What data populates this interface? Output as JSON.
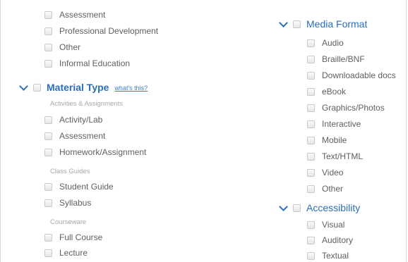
{
  "top_list": [
    "Assessment",
    "Professional Development",
    "Other",
    "Informal Education"
  ],
  "material_type": {
    "title": "Material Type",
    "link": "what's this?",
    "groups": [
      {
        "label": "Activities & Assignments",
        "items": [
          "Activity/Lab",
          "Assessment",
          "Homework/Assignment"
        ]
      },
      {
        "label": "Class Guides",
        "items": [
          "Student Guide",
          "Syllabus"
        ]
      },
      {
        "label": "Courseware",
        "items": [
          "Full Course",
          "Lecture"
        ]
      }
    ]
  },
  "media_format": {
    "title": "Media Format",
    "items": [
      "Audio",
      "Braille/BNF",
      "Downloadable docs",
      "eBook",
      "Graphics/Photos",
      "Interactive",
      "Mobile",
      "Text/HTML",
      "Video",
      "Other"
    ]
  },
  "accessibility": {
    "title": "Accessibility",
    "items": [
      "Visual",
      "Auditory",
      "Textual"
    ]
  },
  "colors": {
    "accent": "#2a6ebb",
    "text": "#606060",
    "muted": "#a9a9a9"
  }
}
